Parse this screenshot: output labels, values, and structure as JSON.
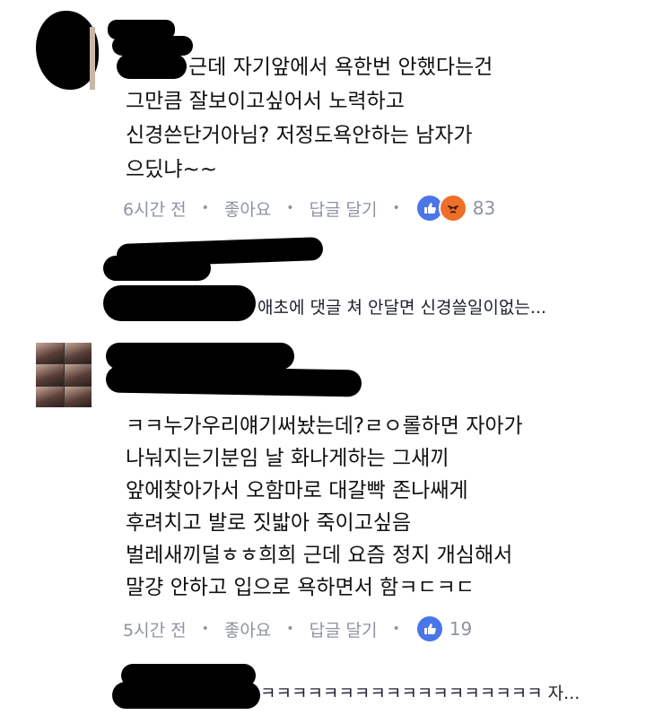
{
  "comment1": {
    "lines": [
      "근데 자기앞에서 욕한번 안했다는건",
      "그만큼 잘보이고싶어서 노력하고",
      "신경쓴단거아님? 저정도욕안하는 남자가",
      "으딨냐~~"
    ],
    "time": "6시간 전",
    "like_label": "좋아요",
    "reply_label": "답글 달기",
    "reactions": [
      "like-icon",
      "angry-icon"
    ],
    "reaction_count": "83"
  },
  "reply_preview": {
    "text": "애초에 댓글 쳐 안달면 신경쓸일이없는..."
  },
  "comment2": {
    "lines": [
      "ㅋㅋ누가우리얘기써놨는데?ㄹㅇ롤하면 자아가",
      "나눠지는기분임 날 화나게하는 그새끼",
      "앞에찾아가서 오함마로 대갈빡 존나쌔게",
      "후려치고 발로 짓밟아 죽이고싶음",
      "벌레새끼덜ㅎㅎ희희 근데 요즘 정지 개심해서",
      "말걍 안하고 입으로 욕하면서 함ㅋㄷㅋㄷ"
    ],
    "time": "5시간 전",
    "like_label": "좋아요",
    "reply_label": "답글 달기",
    "reactions": [
      "like-icon"
    ],
    "reaction_count": "19"
  },
  "reply_preview2": {
    "text": "ㅋㅋㅋㅋㅋㅋㅋㅋㅋㅋㅋㅋㅋㅋㅋㅋㅋㅋ 자..."
  },
  "colors": {
    "text": "#111111",
    "meta": "#8d949e",
    "like": "#4a76e8",
    "angry": "#f06f28"
  }
}
